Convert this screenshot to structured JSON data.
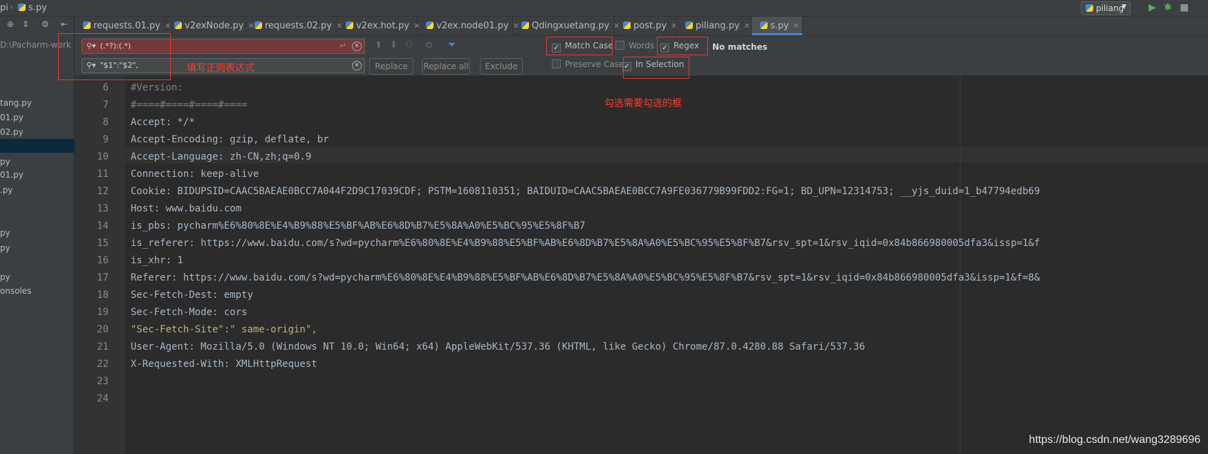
{
  "topbar": {
    "crumb_project": "pi",
    "crumb_file": "s.py",
    "run_config": "piliang",
    "run_icon": "play-icon",
    "debug_icon": "bug-icon",
    "stop_icon": "stop-icon"
  },
  "left_panel": {
    "path": "D:\\Pacharm-work",
    "items": [
      "tang.py",
      "01.py",
      "02.py",
      "py",
      "01.py",
      ".py",
      "py",
      "py",
      "py",
      "onsoles"
    ]
  },
  "tabs": [
    {
      "label": "requests.01.py"
    },
    {
      "label": "v2exNode.py"
    },
    {
      "label": "requests.02.py"
    },
    {
      "label": "v2ex.hot.py"
    },
    {
      "label": "v2ex.node01.py"
    },
    {
      "label": "Qdingxuetang.py"
    },
    {
      "label": "post.py"
    },
    {
      "label": "piliang.py"
    },
    {
      "label": "s.py",
      "active": true
    }
  ],
  "find": {
    "search_value": "(.*?):(.*)",
    "replace_value": "\"$1\":\"$2\",",
    "replace_label": "Replace",
    "replace_all_label": "Replace all",
    "exclude_label": "Exclude",
    "match_case_label": "Match Case",
    "words_label": "Words",
    "regex_label": "Regex",
    "preserve_case_label": "Preserve Case",
    "in_selection_label": "In Selection",
    "status": "No matches",
    "match_case_checked": true,
    "words_checked": false,
    "regex_checked": true,
    "preserve_case_checked": false,
    "in_selection_checked": true
  },
  "annotations": {
    "regex_hint": "填写正则表达式",
    "checkbox_hint": "勾选需要勾选的框"
  },
  "editor": {
    "line_numbers": [
      "6",
      "7",
      "8",
      "9",
      "10",
      "11",
      "12",
      "13",
      "14",
      "15",
      "16",
      "17",
      "18",
      "19",
      "20",
      "21",
      "22",
      "23",
      "24"
    ],
    "lines": [
      "#Version:",
      "#====#====#====#====",
      "Accept: */*",
      "Accept-Encoding: gzip, deflate, br",
      "Accept-Language: zh-CN,zh;q=0.9",
      "Connection: keep-alive",
      "Cookie: BIDUPSID=CAAC5BAEAE0BCC7A044F2D9C17039CDF; PSTM=1608110351; BAIDUID=CAAC5BAEAE0BCC7A9FE036779B99FDD2:FG=1; BD_UPN=12314753; __yjs_duid=1_b47794edb69",
      "Host: www.baidu.com",
      "is_pbs: pycharm%E6%80%8E%E4%B9%88%E5%BF%AB%E6%8D%B7%E5%8A%A0%E5%BC%95%E5%8F%B7",
      "is_referer: https://www.baidu.com/s?wd=pycharm%E6%80%8E%E4%B9%88%E5%BF%AB%E6%8D%B7%E5%8A%A0%E5%BC%95%E5%8F%B7&rsv_spt=1&rsv_iqid=0x84b866980005dfa3&issp=1&f",
      "is_xhr: 1",
      "Referer: https://www.baidu.com/s?wd=pycharm%E6%80%8E%E4%B9%88%E5%BF%AB%E6%8D%B7%E5%8A%A0%E5%BC%95%E5%8F%B7&rsv_spt=1&rsv_iqid=0x84b866980005dfa3&issp=1&f=8&",
      "Sec-Fetch-Dest: empty",
      "Sec-Fetch-Mode: cors",
      "\"Sec-Fetch-Site\":\" same-origin\",",
      "User-Agent: Mozilla/5.0 (Windows NT 10.0; Win64; x64) AppleWebKit/537.36 (KHTML, like Gecko) Chrome/87.0.4280.88 Safari/537.36",
      "X-Requested-With: XMLHttpRequest",
      "",
      ""
    ]
  },
  "watermark": "https://blog.csdn.net/wang3289696"
}
